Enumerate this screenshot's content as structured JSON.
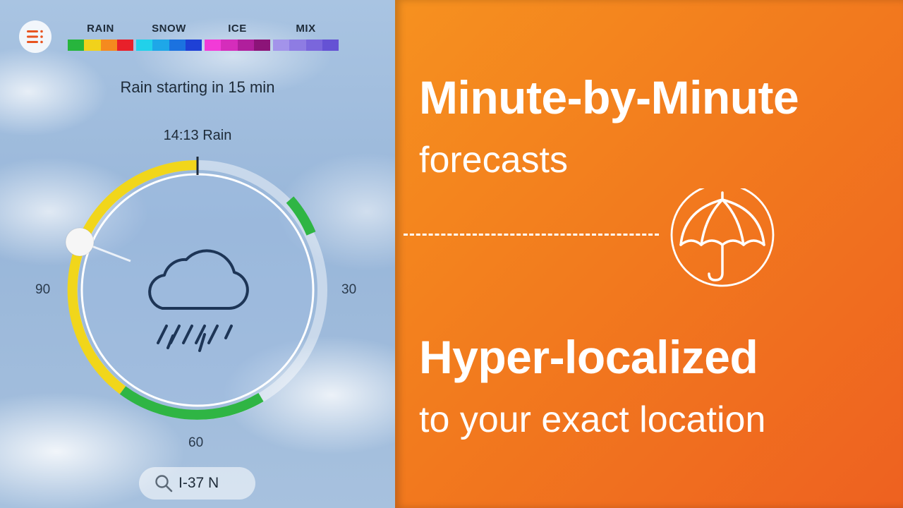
{
  "app": {
    "legend": [
      {
        "label": "RAIN",
        "colors": [
          "#27b53d",
          "#f1d21b",
          "#f58a1f",
          "#e8202a"
        ]
      },
      {
        "label": "SNOW",
        "colors": [
          "#21d1ea",
          "#1ea7e8",
          "#1b72e0",
          "#1e40d6"
        ]
      },
      {
        "label": "ICE",
        "colors": [
          "#f23bd7",
          "#d52dbb",
          "#b01f9c",
          "#8c1478"
        ]
      },
      {
        "label": "MIX",
        "colors": [
          "#a393ea",
          "#8e7ce3",
          "#7a66dc",
          "#6552d4"
        ]
      }
    ],
    "alert_text": "Rain starting in 15 min",
    "pin_label": "14:13 Rain",
    "dial_ticks": {
      "right": "30",
      "bottom": "60",
      "left": "90"
    },
    "search_value": "I-37 N",
    "icons": {
      "menu": "menu-list-icon",
      "weather": "cloud-rain-icon",
      "search": "search-icon"
    },
    "dial_colors": {
      "rain_yellow": "#f1d61b",
      "rain_green": "#2fb544"
    }
  },
  "promo": {
    "headline1": "Minute-by-Minute",
    "subline1": "forecasts",
    "headline2": "Hyper-localized",
    "subline2": "to your exact location",
    "icon": "umbrella-icon",
    "accent": "#f27b1e"
  }
}
